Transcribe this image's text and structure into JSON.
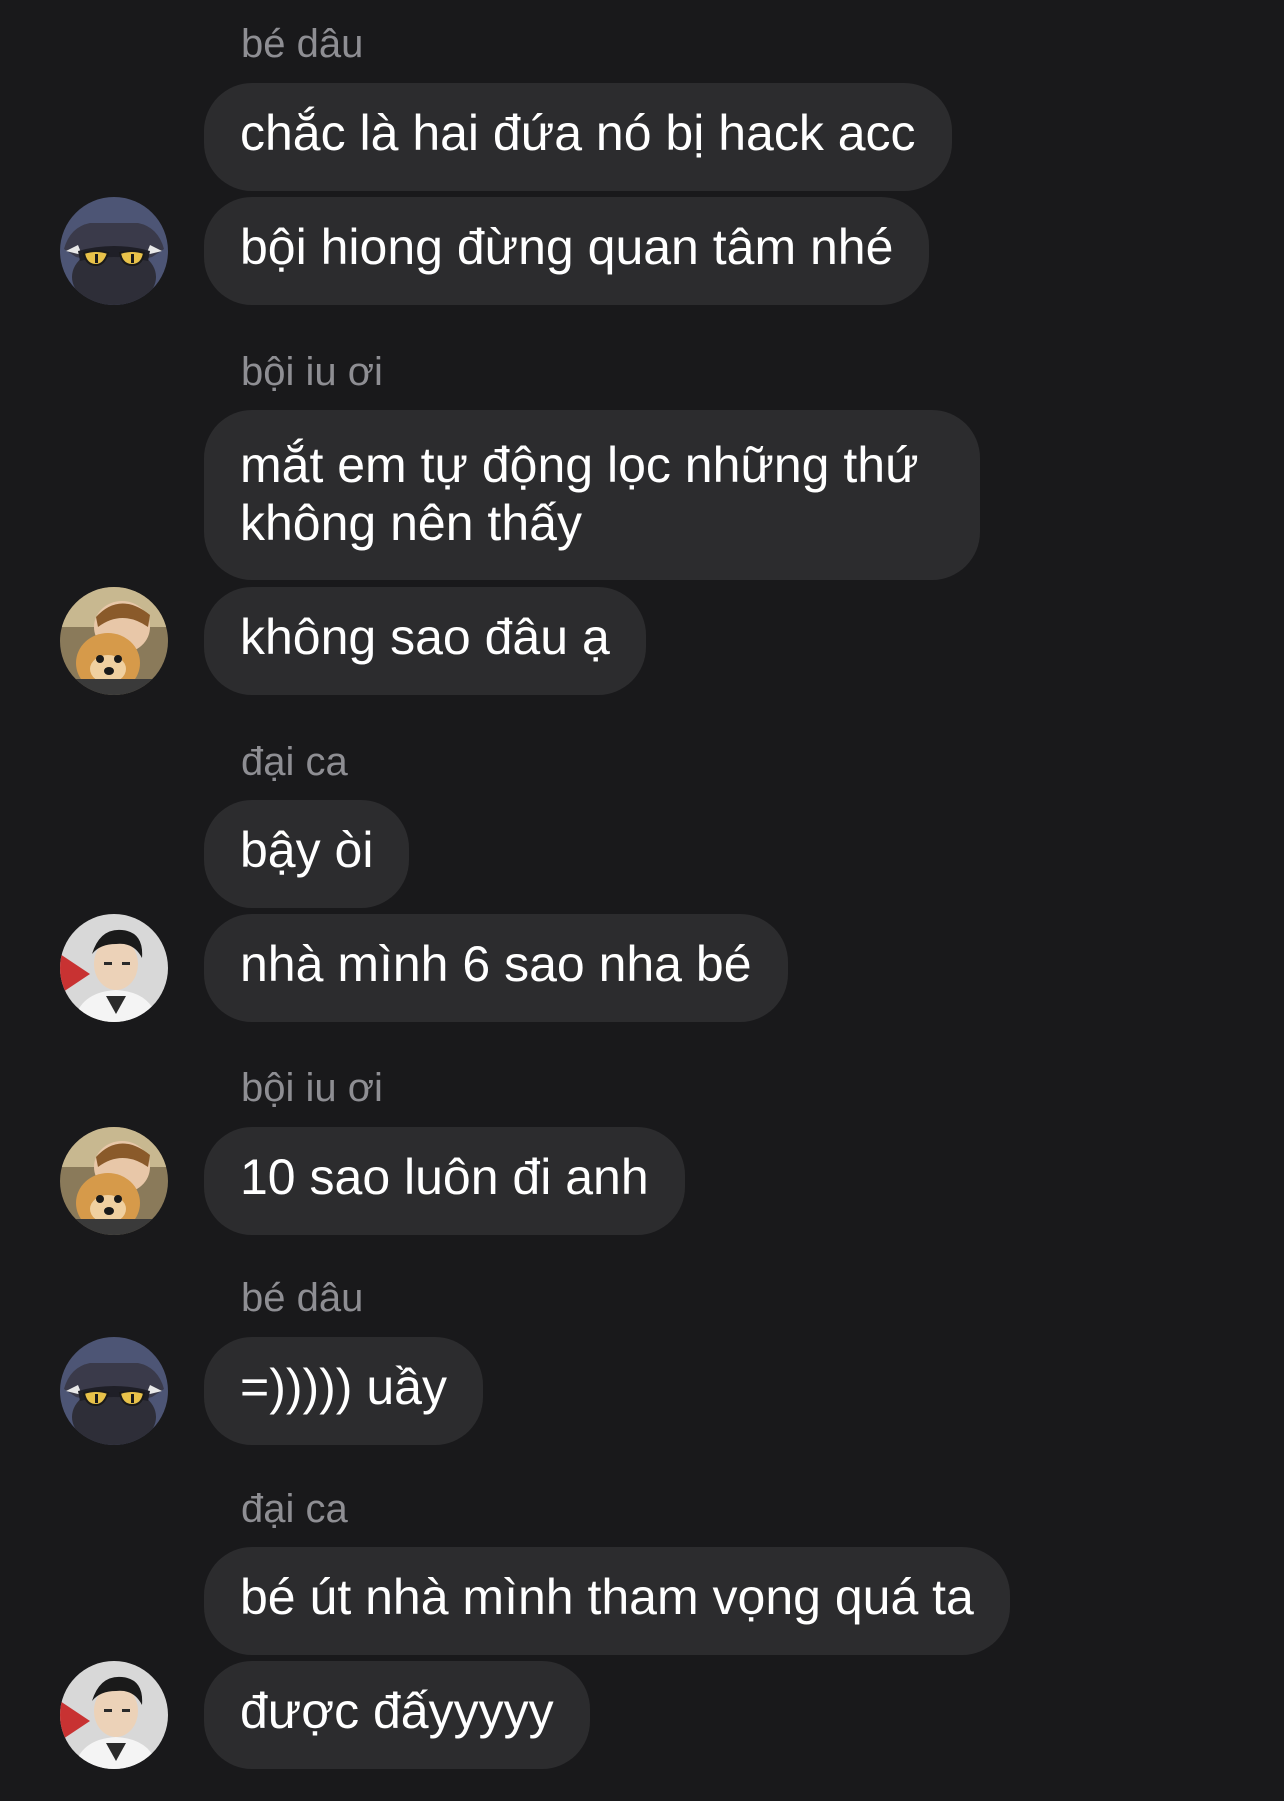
{
  "messages": [
    {
      "sender": "bé dâu",
      "avatar": "cat-avatar-icon",
      "bubbles": [
        "chắc là hai đứa nó bị hack acc",
        "bội hiong đừng quan tâm nhé"
      ]
    },
    {
      "sender": "bội iu ơi",
      "avatar": "boy-with-dog-avatar-icon",
      "bubbles": [
        "mắt em tự động lọc những thứ không nên thấy",
        "không sao đâu ạ"
      ]
    },
    {
      "sender": "đại ca",
      "avatar": "boy-portrait-avatar-icon",
      "bubbles": [
        "bậy òi",
        "nhà mình 6 sao nha bé"
      ]
    },
    {
      "sender": "bội iu ơi",
      "avatar": "boy-with-dog-avatar-icon",
      "bubbles": [
        "10 sao luôn đi anh"
      ]
    },
    {
      "sender": "bé dâu",
      "avatar": "cat-avatar-icon",
      "bubbles": [
        "=))))) uầy"
      ]
    },
    {
      "sender": "đại ca",
      "avatar": "boy-portrait-avatar-icon",
      "bubbles": [
        "bé út nhà mình tham vọng quá ta",
        "được đấyyyyy"
      ]
    }
  ],
  "colors": {
    "background": "#19191b",
    "bubble": "#2c2c2e",
    "sender_text": "#8e8e93",
    "message_text": "#ffffff"
  }
}
